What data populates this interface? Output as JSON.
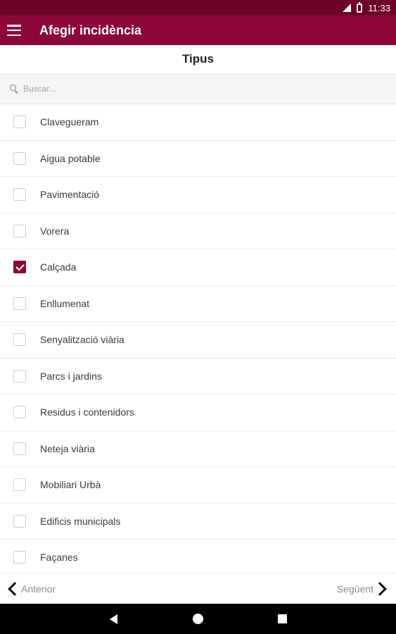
{
  "status_bar": {
    "time": "11:33",
    "icons": [
      "signal-icon",
      "battery-icon"
    ]
  },
  "app_bar": {
    "title": "Afegir incidència",
    "menu_icon": "hamburger-menu-icon"
  },
  "section": {
    "title": "Tipus"
  },
  "search": {
    "placeholder": "Buscar...",
    "value": "",
    "icon": "search-icon"
  },
  "types": [
    {
      "label": "Clavegueram",
      "checked": false
    },
    {
      "label": "Aigua potable",
      "checked": false
    },
    {
      "label": "Pavimentació",
      "checked": false
    },
    {
      "label": "Vorera",
      "checked": false
    },
    {
      "label": "Calçada",
      "checked": true
    },
    {
      "label": "Enllumenat",
      "checked": false
    },
    {
      "label": "Senyalització viària",
      "checked": false
    },
    {
      "label": "Parcs i jardins",
      "checked": false
    },
    {
      "label": "Residus i contenidors",
      "checked": false
    },
    {
      "label": "Neteja viària",
      "checked": false
    },
    {
      "label": "Mobiliari Urbà",
      "checked": false
    },
    {
      "label": "Edificis municipals",
      "checked": false
    },
    {
      "label": "Façanes",
      "checked": false
    }
  ],
  "footer": {
    "prev_label": "Anterior",
    "next_label": "Següent"
  },
  "android_nav": {
    "keys": [
      "back-icon",
      "home-icon",
      "recents-icon"
    ]
  },
  "colors": {
    "accent": "#8d0638",
    "status_bar": "#6d0329"
  }
}
